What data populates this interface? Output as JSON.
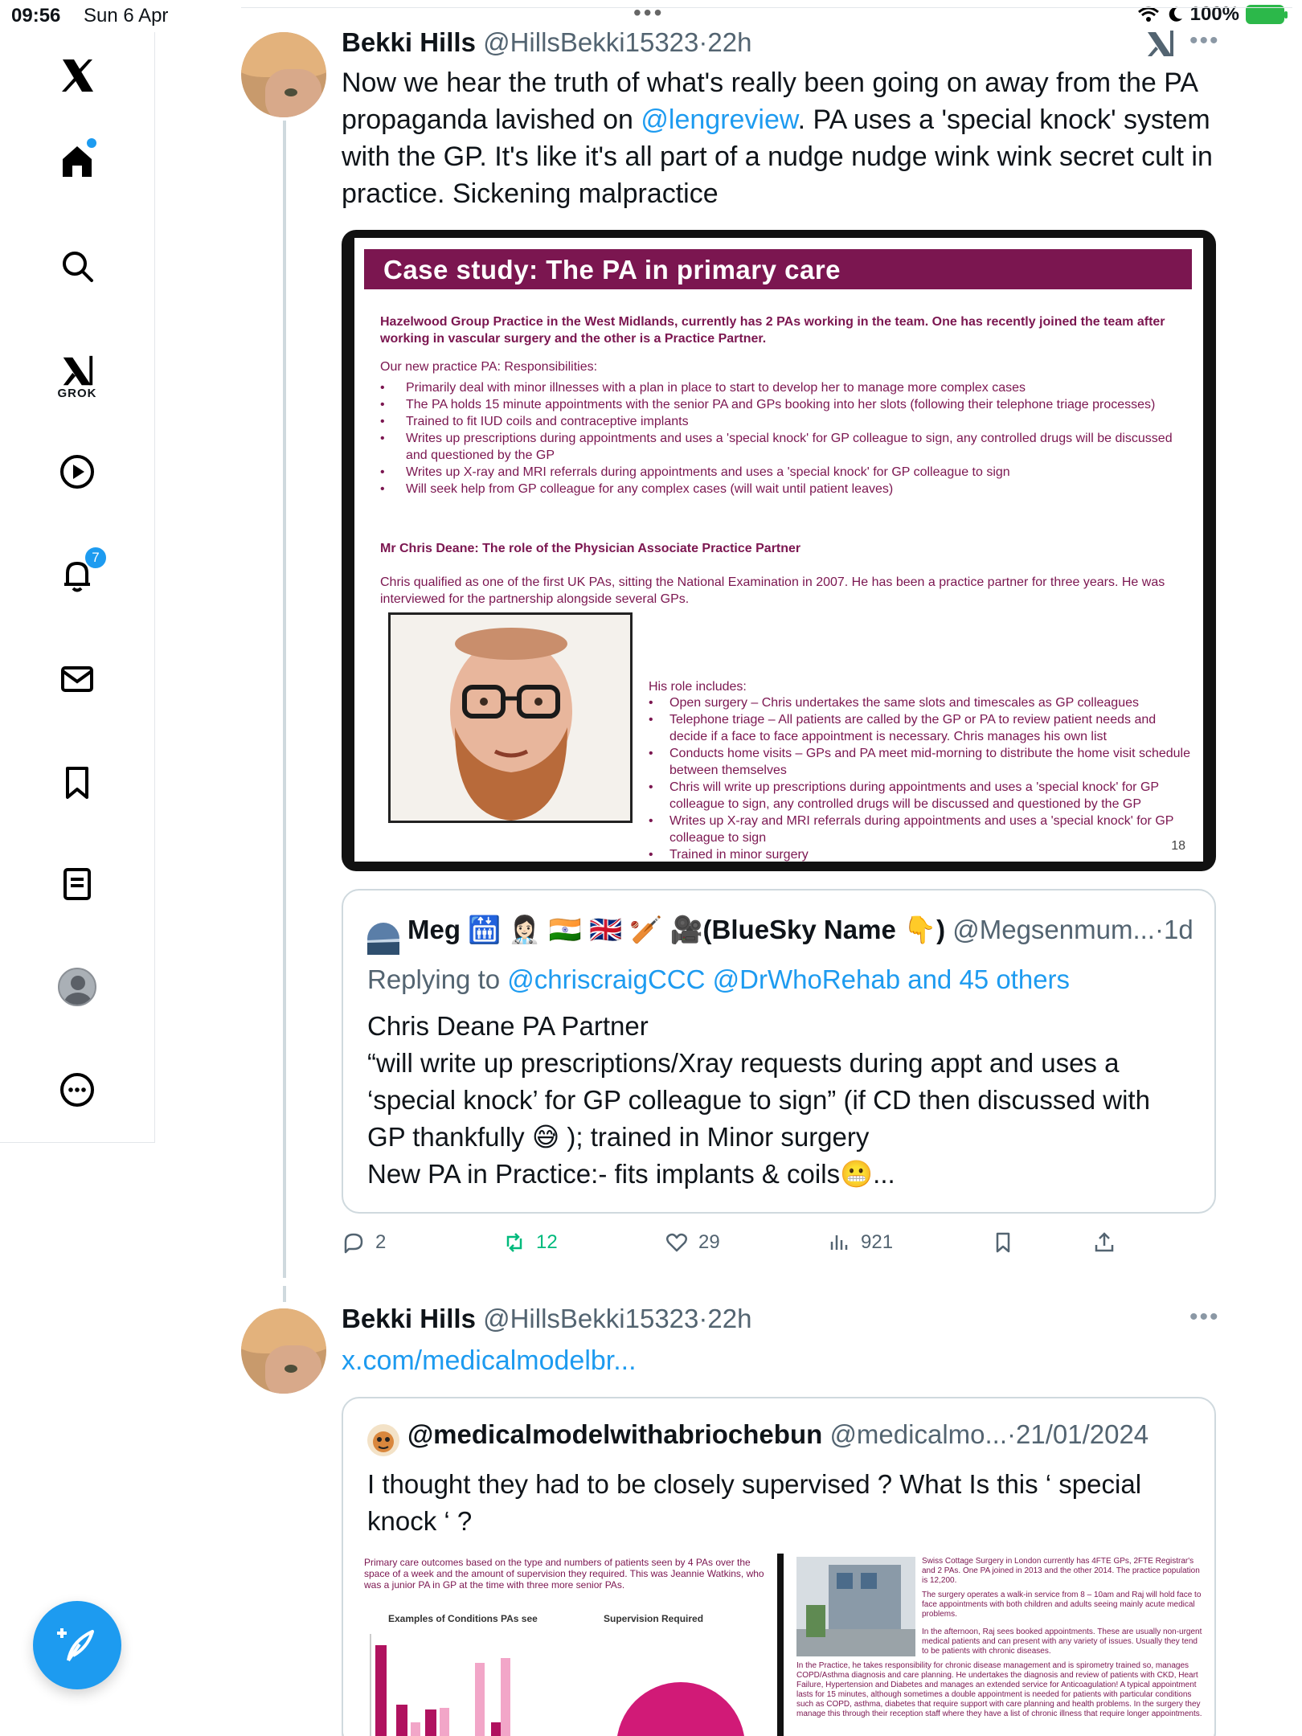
{
  "status": {
    "time": "09:56",
    "date": "Sun 6 Apr",
    "battery": "100%"
  },
  "sidebar": {
    "items": [
      {
        "name": "x-logo"
      },
      {
        "name": "home"
      },
      {
        "name": "search"
      },
      {
        "name": "grok",
        "label": "GROK"
      },
      {
        "name": "video"
      },
      {
        "name": "notifications",
        "badge": "7"
      },
      {
        "name": "messages"
      },
      {
        "name": "bookmarks"
      },
      {
        "name": "lists"
      },
      {
        "name": "profile"
      },
      {
        "name": "more"
      }
    ]
  },
  "tweet1": {
    "name": "Bekki Hills",
    "handle": "@HillsBekki15323",
    "time": "22h",
    "text_before": "Now we hear the truth of what's really been going on away from the PA propaganda lavished on ",
    "mention": "@lengreview",
    "text_after": ". PA uses a 'special knock' system with the GP. It's like it's all part of a nudge nudge wink wink secret cult in practice. Sickening malpractice",
    "slide": {
      "title": "Case study: The PA in primary care",
      "intro": "Hazelwood Group Practice in the West Midlands, currently has 2 PAs working in the team. One has recently joined the team after working in vascular surgery and the other is a Practice Partner.",
      "resp_heading": "Our new practice PA: Responsibilities:",
      "bullets": [
        "Primarily deal with minor illnesses with a plan in place to start to develop her to manage more complex cases",
        "The PA holds 15 minute appointments with the senior PA and GPs booking into her slots (following their telephone triage processes)",
        "Trained to fit IUD coils and contraceptive implants",
        "Writes up prescriptions during appointments and uses a 'special knock' for GP colleague to sign, any controlled drugs will be discussed and questioned by the GP",
        "Writes up X-ray and MRI referrals during appointments and uses a 'special knock' for GP colleague to sign",
        "Will seek help from GP colleague for any complex cases (will wait until patient leaves)"
      ],
      "partner_heading": "Mr Chris Deane: The role of the Physician Associate Practice Partner",
      "partner_text": "Chris qualified as one of the first UK PAs, sitting the National Examination in 2007. He has been a practice partner for three years. He was interviewed for the partnership alongside several GPs.",
      "role_heading": "His role includes:",
      "role_bullets": [
        "Open surgery – Chris undertakes the same slots and timescales as GP colleagues",
        "Telephone triage – All patients are called by the GP or PA to review patient needs and decide if a face to face appointment is necessary. Chris manages his own list",
        "Conducts home visits – GPs and PA meet mid-morning to distribute the home visit schedule between themselves",
        "Chris will write up prescriptions during appointments and uses a 'special knock' for GP colleague to sign, any controlled drugs will be discussed and questioned by the GP",
        "Writes up X-ray and MRI referrals during appointments and uses a 'special knock' for GP colleague to sign",
        "Trained in minor surgery"
      ],
      "page_number": "18"
    },
    "quote": {
      "name": "Meg 🛗 👩🏻‍⚕️ 🇮🇳 🇬🇧 🏏 🎥(BlueSky Name 👇)",
      "handle": "@Megsenmum...",
      "time": "1d",
      "replying_label": "Replying to ",
      "replying_to": "@chriscraigCCC @DrWhoRehab and 45 others",
      "lines": [
        "Chris Deane PA Partner",
        "“will write up prescriptions/Xray requests during appt and uses a ‘special knock’ for GP colleague to sign” (if CD then discussed with GP thankfully 😅 ); trained in Minor surgery",
        "New PA in Practice:- fits implants & coils😬..."
      ]
    },
    "stats": {
      "replies": "2",
      "retweets": "12",
      "likes": "29",
      "views": "921"
    }
  },
  "tweet2": {
    "name": "Bekki Hills",
    "handle": "@HillsBekki15323",
    "time": "22h",
    "link": "x.com/medicalmodelbr...",
    "quote": {
      "name": "@medicalmodelwithabriochebun",
      "handle": "@medicalmo...",
      "date": "21/01/2024",
      "text": "I thought they had to be closely supervised ? What Is this ‘ special knock ‘ ?",
      "thumb1": {
        "caption": "Primary care outcomes based on the type and numbers of patients seen by 4 PAs over the space of a week and the amount of supervision they required. This was Jeannie Watkins, who was a junior PA in GP at the time with three more senior PAs.",
        "left_title": "Examples of Conditions PAs see",
        "right_title": "Supervision Required"
      },
      "thumb2": {
        "text1": "Swiss Cottage Surgery in London currently has 4FTE GPs, 2FTE Registrar's and 2 PAs. One PA joined in 2013 and the other 2014. The practice population is 12,200.",
        "text2": "The surgery operates a walk-in service from 8 – 10am and Raj will hold face to face appointments with both children and adults seeing mainly acute medical problems.",
        "text3": "In the afternoon, Raj sees booked appointments. These are usually non-urgent medical patients and can present with any variety of issues. Usually they tend to be patients with chronic diseases.",
        "text4": "In the Practice, he takes responsibility for chronic disease management and is spirometry trained so, manages COPD/Asthma diagnosis and care planning. He undertakes the diagnosis and review of patients with CKD, Heart Failure, Hypertension and Diabetes and manages an extended service for Anticoagulation! A typical appointment lasts for 15 minutes, although sometimes a double appointment is needed for patients with particular conditions such as COPD, asthma, diabetes that require support with care planning and health problems. In the surgery they manage this through their reception staff where they have a list of chronic illness that require longer appointments."
      }
    }
  },
  "colors": {
    "accent": "#1d9bf0",
    "retweet": "#00ba7c",
    "slide": "#7b1650"
  }
}
